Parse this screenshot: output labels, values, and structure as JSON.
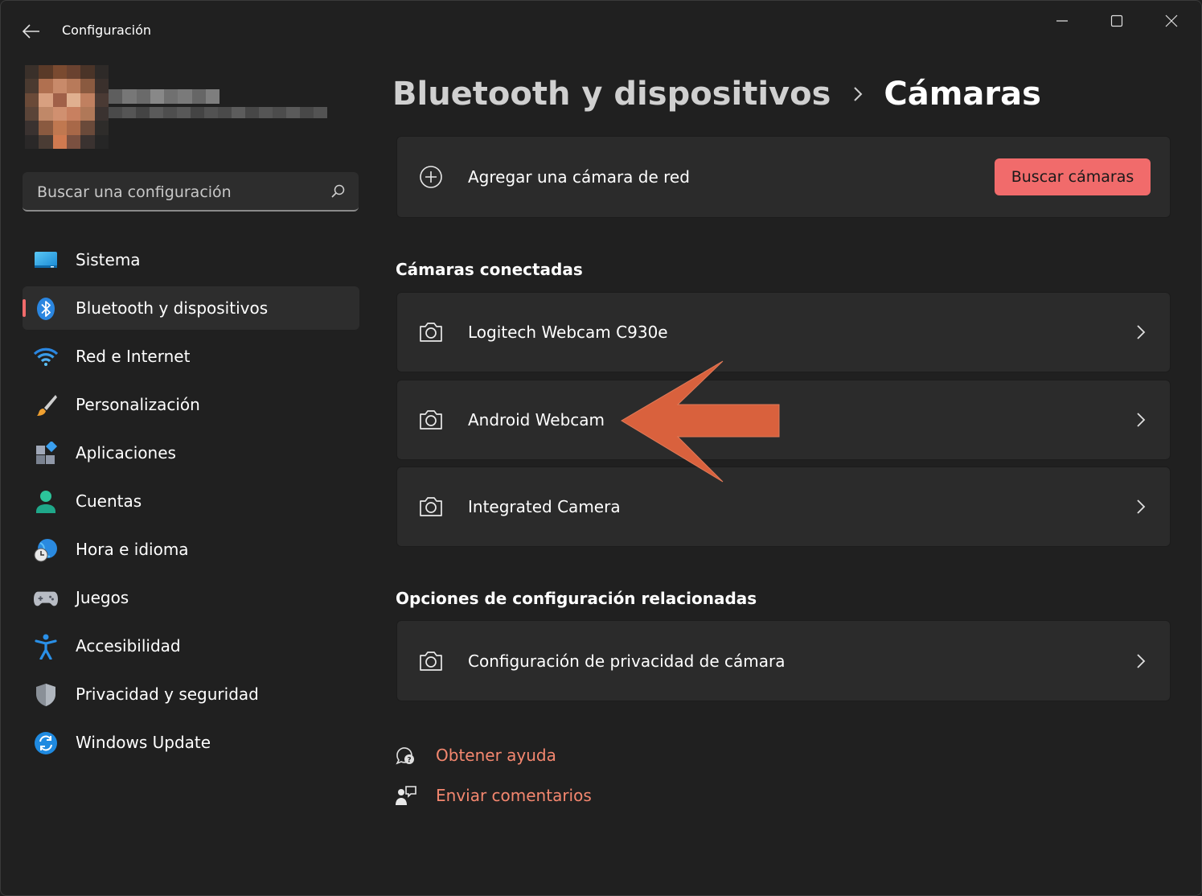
{
  "window": {
    "title": "Configuración"
  },
  "search": {
    "placeholder": "Buscar una configuración"
  },
  "nav": [
    {
      "label": "Sistema",
      "icon": "monitor-icon"
    },
    {
      "label": "Bluetooth y dispositivos",
      "icon": "bluetooth-icon",
      "active": true
    },
    {
      "label": "Red e Internet",
      "icon": "wifi-icon"
    },
    {
      "label": "Personalización",
      "icon": "paintbrush-icon"
    },
    {
      "label": "Aplicaciones",
      "icon": "apps-icon"
    },
    {
      "label": "Cuentas",
      "icon": "person-icon"
    },
    {
      "label": "Hora e idioma",
      "icon": "globe-clock-icon"
    },
    {
      "label": "Juegos",
      "icon": "gamepad-icon"
    },
    {
      "label": "Accesibilidad",
      "icon": "accessibility-icon"
    },
    {
      "label": "Privacidad y seguridad",
      "icon": "shield-icon"
    },
    {
      "label": "Windows Update",
      "icon": "refresh-icon"
    }
  ],
  "breadcrumb": {
    "parent": "Bluetooth y dispositivos",
    "current": "Cámaras"
  },
  "add_camera": {
    "label": "Agregar una cámara de red",
    "button": "Buscar cámaras"
  },
  "connected": {
    "title": "Cámaras conectadas",
    "items": [
      {
        "label": "Logitech Webcam C930e"
      },
      {
        "label": "Android Webcam"
      },
      {
        "label": "Integrated Camera"
      }
    ]
  },
  "related": {
    "title": "Opciones de configuración relacionadas",
    "items": [
      {
        "label": "Configuración de privacidad de cámara"
      }
    ]
  },
  "links": {
    "help": "Obtener ayuda",
    "feedback": "Enviar comentarios"
  },
  "colors": {
    "accent": "#f16b6b",
    "link": "#f4876f",
    "arrow": "#d9613d",
    "background": "#202020",
    "card": "#2b2b2b"
  }
}
